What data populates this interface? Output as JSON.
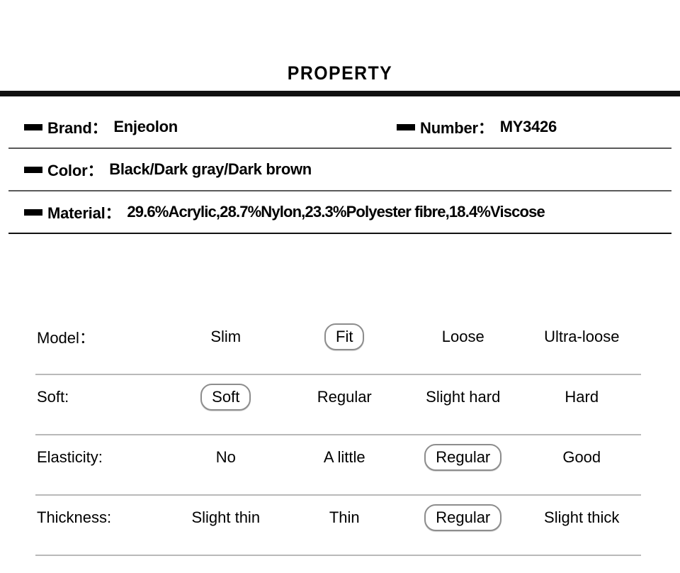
{
  "header": {
    "title": "PROPERTY"
  },
  "specs": [
    {
      "name": "brand",
      "label": "Brand：",
      "value": "Enjeolon",
      "side": "left",
      "pair": [
        {
          "name": "brand",
          "label": "Brand：",
          "value": "Enjeolon"
        },
        {
          "name": "number",
          "label": "Number：",
          "value": "MY3426"
        }
      ]
    },
    {
      "name": "color",
      "label": "Color：",
      "value": "Black/Dark gray/Dark brown"
    },
    {
      "name": "material",
      "label": "Material：",
      "value": "29.6%Acrylic,28.7%Nylon,23.3%Polyester fibre,18.4%Viscose"
    }
  ],
  "spec_rows": {
    "brand_label": "Brand：",
    "brand_value": "Enjeolon",
    "number_label": "Number：",
    "number_value": "MY3426",
    "color_label": "Color：",
    "color_value": "Black/Dark gray/Dark brown",
    "material_label": "Material：",
    "material_value": "29.6%Acrylic,28.7%Nylon,23.3%Polyester fibre,18.4%Viscose"
  },
  "attributes": [
    {
      "name": "model",
      "label": "Model：",
      "options": [
        "Slim",
        "Fit",
        "Loose",
        "Ultra-loose"
      ],
      "selected": "Fit",
      "selected_index": 1
    },
    {
      "name": "soft",
      "label": "Soft:",
      "options": [
        "Soft",
        "Regular",
        "Slight hard",
        "Hard"
      ],
      "selected": "Soft",
      "selected_index": 0
    },
    {
      "name": "elasticity",
      "label": "Elasticity:",
      "options": [
        "No",
        "A little",
        "Regular",
        "Good"
      ],
      "selected": "Regular",
      "selected_index": 2
    },
    {
      "name": "thickness",
      "label": "Thickness:",
      "options": [
        "Slight thin",
        "Thin",
        "Regular",
        "Slight thick"
      ],
      "selected": "Regular",
      "selected_index": 2
    }
  ],
  "colors": {
    "text": "#000000",
    "rule": "#111111",
    "spec_divider": "#5a5a5a",
    "attr_divider": "#b9b9b9",
    "selected_border": "#8d8d8d",
    "background": "#ffffff"
  }
}
